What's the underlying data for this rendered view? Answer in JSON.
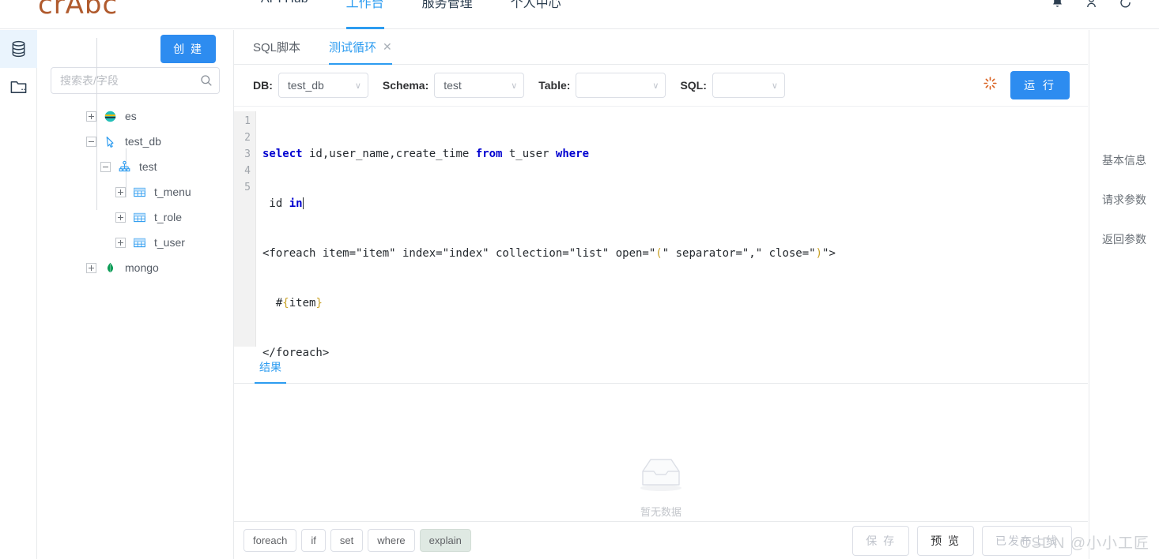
{
  "header": {
    "logo_text": "crAbc",
    "nav": [
      {
        "label": "API Hub",
        "active": false
      },
      {
        "label": "工作台",
        "active": true
      },
      {
        "label": "服务管理",
        "active": false
      },
      {
        "label": "个人中心",
        "active": false
      }
    ],
    "icons": [
      "bell-icon",
      "user-icon",
      "logout-icon"
    ]
  },
  "rail": {
    "items": [
      {
        "name": "database-icon",
        "active": true
      },
      {
        "name": "folder-icon",
        "active": false
      }
    ]
  },
  "left_panel": {
    "create_label": "创 建",
    "search_placeholder": "搜索表/字段",
    "search_value": "",
    "tree": [
      {
        "label": "es",
        "icon": "elasticsearch-icon",
        "expander": "plus",
        "depth": 0
      },
      {
        "label": "test_db",
        "icon": "datasource-icon",
        "expander": "minus",
        "depth": 0
      },
      {
        "label": "test",
        "icon": "schema-icon",
        "expander": "minus",
        "depth": 1
      },
      {
        "label": "t_menu",
        "icon": "table-icon",
        "expander": "plus",
        "depth": 2
      },
      {
        "label": "t_role",
        "icon": "table-icon",
        "expander": "plus",
        "depth": 2
      },
      {
        "label": "t_user",
        "icon": "table-icon",
        "expander": "plus",
        "depth": 2
      },
      {
        "label": "mongo",
        "icon": "mongodb-icon",
        "expander": "plus",
        "depth": 0
      }
    ]
  },
  "main": {
    "tabs": [
      {
        "label": "SQL脚本",
        "active": false,
        "closable": false
      },
      {
        "label": "测试循环",
        "active": true,
        "closable": true,
        "close_glyph": "✕"
      }
    ],
    "query_bar": {
      "db_label": "DB:",
      "db_value": "test_db",
      "schema_label": "Schema:",
      "schema_value": "test",
      "table_label": "Table:",
      "table_value": "",
      "sql_label": "SQL:",
      "sql_value": "",
      "loading_icon": "sunburst-loading-icon",
      "run_label": "运 行"
    },
    "editor": {
      "line_numbers": [
        "1",
        "2",
        "3",
        "4",
        "5"
      ],
      "lines": [
        "select id,user_name,create_time from t_user where",
        " id in",
        "<foreach item=\"item\" index=\"index\" collection=\"list\" open=\"(\" separator=\",\" close=\")\">",
        "  #{item}",
        "</foreach>"
      ]
    },
    "result": {
      "tab_label": "结果",
      "empty_text": "暂无数据",
      "empty_icon": "empty-box-icon"
    },
    "bottom_bar": {
      "tags": [
        {
          "label": "foreach",
          "highlighted": false
        },
        {
          "label": "if",
          "highlighted": false
        },
        {
          "label": "set",
          "highlighted": false
        },
        {
          "label": "where",
          "highlighted": false
        },
        {
          "label": "explain",
          "highlighted": true
        }
      ],
      "actions": [
        {
          "label": "保 存",
          "disabled": true
        },
        {
          "label": "预 览",
          "disabled": false
        },
        {
          "label": "已发布上线",
          "disabled": true
        }
      ]
    }
  },
  "right_panel": {
    "items": [
      "基本信息",
      "请求参数",
      "返回参数"
    ]
  },
  "watermark": "CSDN @小小工匠",
  "colors": {
    "accent": "#2d8cf0",
    "logo": "#b05a2d",
    "border": "#e8eaec",
    "muted": "#c0c4cc",
    "highlight_tag": "#dfe9e3"
  }
}
